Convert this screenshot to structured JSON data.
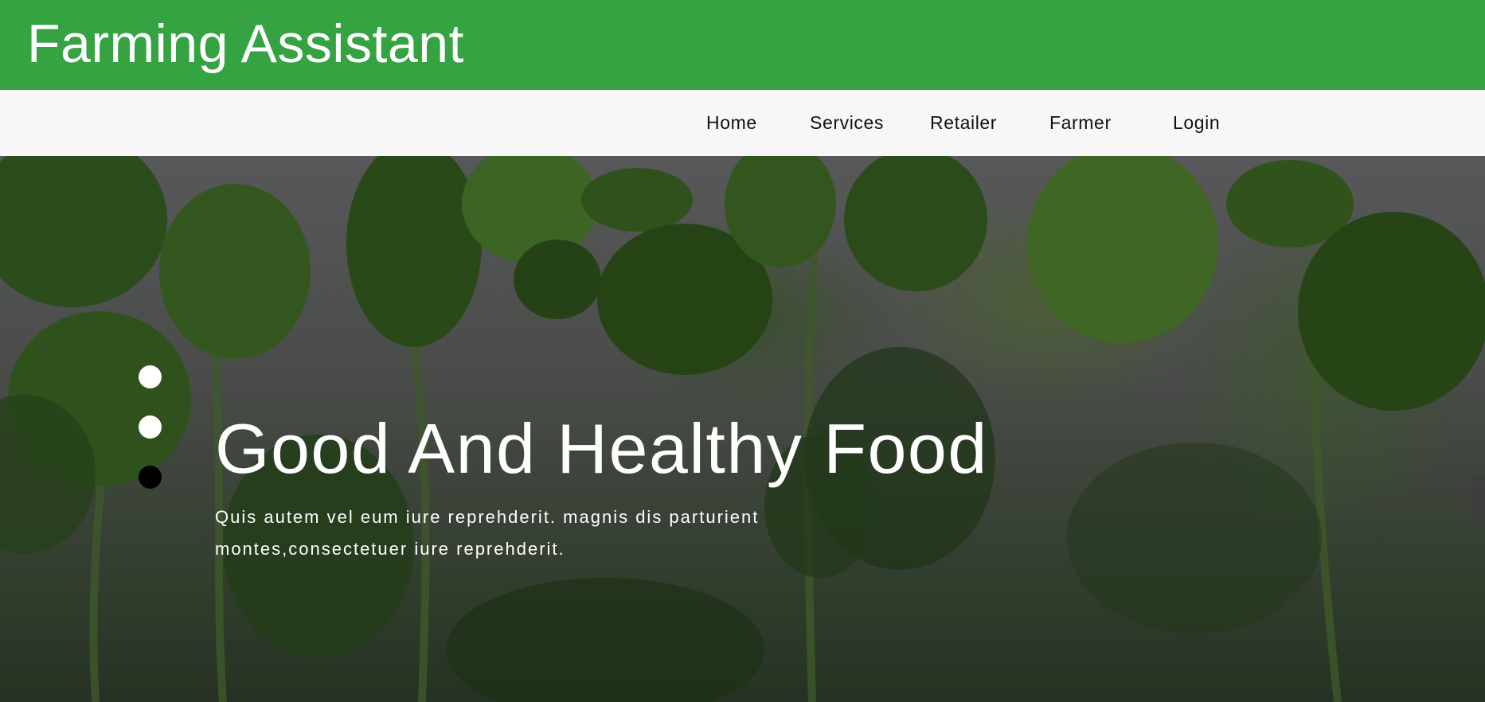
{
  "header": {
    "brand": "Farming Assistant",
    "color": "#36a343"
  },
  "nav": {
    "items": [
      "Home",
      "Services",
      "Retailer",
      "Farmer",
      "Login"
    ]
  },
  "hero": {
    "title": "Good And Healthy Food",
    "subtitle": "Quis autem vel eum iure reprehderit. magnis dis parturient montes,consectetuer iure reprehderit.",
    "indicators": {
      "count": 3,
      "active": 3
    }
  }
}
